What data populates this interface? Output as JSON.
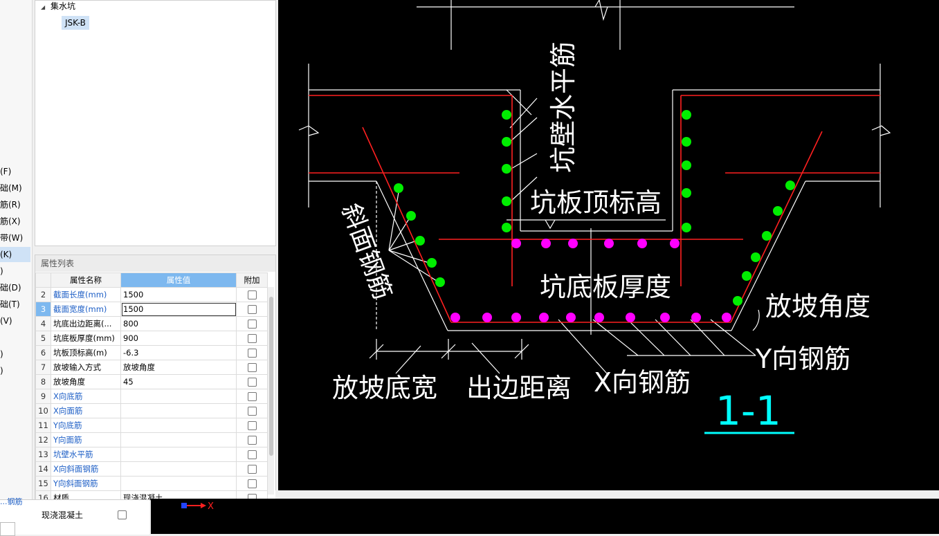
{
  "left_strip": {
    "items": [
      "(F)",
      "础(M)",
      "筋(R)",
      "筋(X)",
      "带(W)",
      "(K)",
      ")",
      "础(D)",
      "础(T)",
      "(V)",
      ")",
      ")"
    ]
  },
  "tree": {
    "parent_label": "集水坑",
    "child_label": "JSK-B"
  },
  "properties": {
    "panel_title": "属性列表",
    "headers": {
      "name": "属性名称",
      "value": "属性值",
      "extra": "附加"
    },
    "rows": [
      {
        "num": "2",
        "name": "截面长度(mm)",
        "value": "1500"
      },
      {
        "num": "3",
        "name": "截面宽度(mm)",
        "value": "1500"
      },
      {
        "num": "4",
        "name": "坑底出边距离(...",
        "value": "800"
      },
      {
        "num": "5",
        "name": "坑底板厚度(mm)",
        "value": "900"
      },
      {
        "num": "6",
        "name": "坑板顶标高(m)",
        "value": "-6.3"
      },
      {
        "num": "7",
        "name": "放坡输入方式",
        "value": "放坡角度"
      },
      {
        "num": "8",
        "name": "放坡角度",
        "value": "45"
      },
      {
        "num": "9",
        "name": "X向底筋",
        "value": ""
      },
      {
        "num": "10",
        "name": "X向面筋",
        "value": ""
      },
      {
        "num": "11",
        "name": "Y向底筋",
        "value": ""
      },
      {
        "num": "12",
        "name": "Y向面筋",
        "value": ""
      },
      {
        "num": "13",
        "name": "坑壁水平筋",
        "value": ""
      },
      {
        "num": "14",
        "name": "X向斜面钢筋",
        "value": ""
      },
      {
        "num": "15",
        "name": "Y向斜面钢筋",
        "value": ""
      },
      {
        "num": "16",
        "name": "材质",
        "value": "现浇混凝土"
      }
    ],
    "bottom_partial": {
      "name": "...钢筋",
      "value": "现浇混凝土"
    }
  },
  "drawing": {
    "labels": {
      "wall_horizontal": "坑壁水平筋",
      "slab_top_elevation": "坑板顶标高",
      "slope_rebar": "斜面钢筋",
      "bottom_slab_thickness": "坑底板厚度",
      "slope_angle": "放坡角度",
      "y_rebar": "Y向钢筋",
      "x_rebar": "X向钢筋",
      "slope_bottom_width": "放坡底宽",
      "edge_distance": "出边距离",
      "section": "1-1"
    },
    "axis_label": "X",
    "colors": {
      "rebar_line": "#ff0000",
      "wall_dots": "#00ee00",
      "slab_dots": "#ff00ff",
      "section_label": "#00ffff",
      "axis": "#ff0000"
    }
  }
}
